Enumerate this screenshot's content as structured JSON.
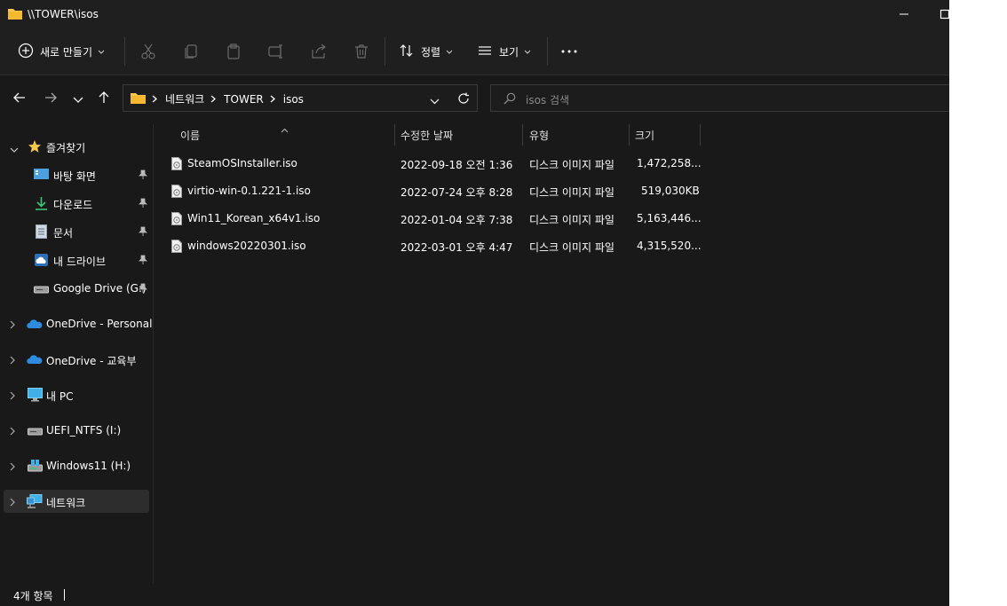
{
  "window": {
    "title": "\\\\TOWER\\isos"
  },
  "toolbar": {
    "new_label": "새로 만들기",
    "sort_label": "정렬",
    "view_label": "보기"
  },
  "address": {
    "crumbs": [
      "네트워크",
      "TOWER",
      "isos"
    ]
  },
  "search": {
    "placeholder": "isos 검색"
  },
  "sidebar": {
    "quick_access": "즐겨찾기",
    "pinned": [
      "바탕 화면",
      "다운로드",
      "문서",
      "내 드라이브",
      "Google Drive (G:)"
    ],
    "roots": [
      "OneDrive - Personal",
      "OneDrive - 교육부",
      "내 PC",
      "UEFI_NTFS (I:)",
      "Windows11 (H:)",
      "네트워크"
    ]
  },
  "columns": {
    "name": "이름",
    "modified": "수정한 날짜",
    "type": "유형",
    "size": "크기"
  },
  "files": [
    {
      "name": "SteamOSInstaller.iso",
      "modified": "2022-09-18 오전 1:36",
      "type": "디스크 이미지 파일",
      "size": "1,472,258..."
    },
    {
      "name": "virtio-win-0.1.221-1.iso",
      "modified": "2022-07-24 오후 8:28",
      "type": "디스크 이미지 파일",
      "size": "519,030KB"
    },
    {
      "name": "Win11_Korean_x64v1.iso",
      "modified": "2022-01-04 오후 7:38",
      "type": "디스크 이미지 파일",
      "size": "5,163,446..."
    },
    {
      "name": "windows20220301.iso",
      "modified": "2022-03-01 오후 4:47",
      "type": "디스크 이미지 파일",
      "size": "4,315,520..."
    }
  ],
  "status": {
    "count": "4개 항목"
  },
  "colors": {
    "background": "#191919",
    "chrome": "#1f1f1f",
    "folder_yellow": "#f8c84a",
    "accent_blue": "#4ca0e0",
    "selection": "#2d2d2d"
  }
}
